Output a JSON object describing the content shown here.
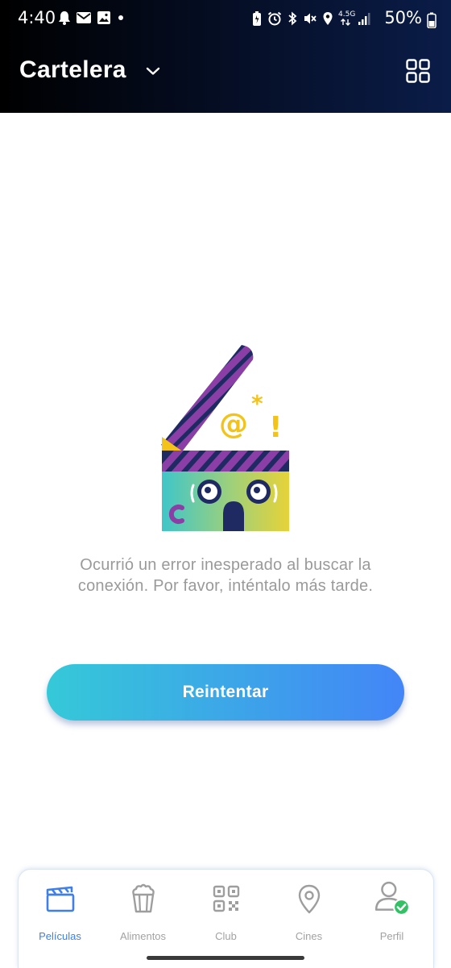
{
  "status_bar": {
    "time": "4:40",
    "network": "4.5G",
    "battery": "50%"
  },
  "app_bar": {
    "title": "Cartelera",
    "icons": {
      "dropdown": "chevron-down-icon",
      "grid_view": "grid-view-icon"
    }
  },
  "error": {
    "illustration": "clapperboard-error-illustration",
    "message": "Ocurrió un error inesperado al buscar la conexión. Por favor, inténtalo más tarde.",
    "retry_label": "Reintentar"
  },
  "bottom_nav": {
    "items": [
      {
        "label": "Películas",
        "icon": "clapperboard-icon",
        "active": true
      },
      {
        "label": "Alimentos",
        "icon": "popcorn-icon",
        "active": false
      },
      {
        "label": "Club",
        "icon": "qr-code-icon",
        "active": false
      },
      {
        "label": "Cines",
        "icon": "map-pin-icon",
        "active": false
      },
      {
        "label": "Perfil",
        "icon": "user-check-icon",
        "active": false
      }
    ]
  },
  "colors": {
    "header_dark": "#000000",
    "header_navy": "#0a1c48",
    "button_start": "#35c9d8",
    "button_end": "#4385f7",
    "nav_active": "#3f7fe6",
    "nav_inactive": "#a2a2a2",
    "message_text": "#9a9a9a",
    "check_badge": "#34c065"
  }
}
